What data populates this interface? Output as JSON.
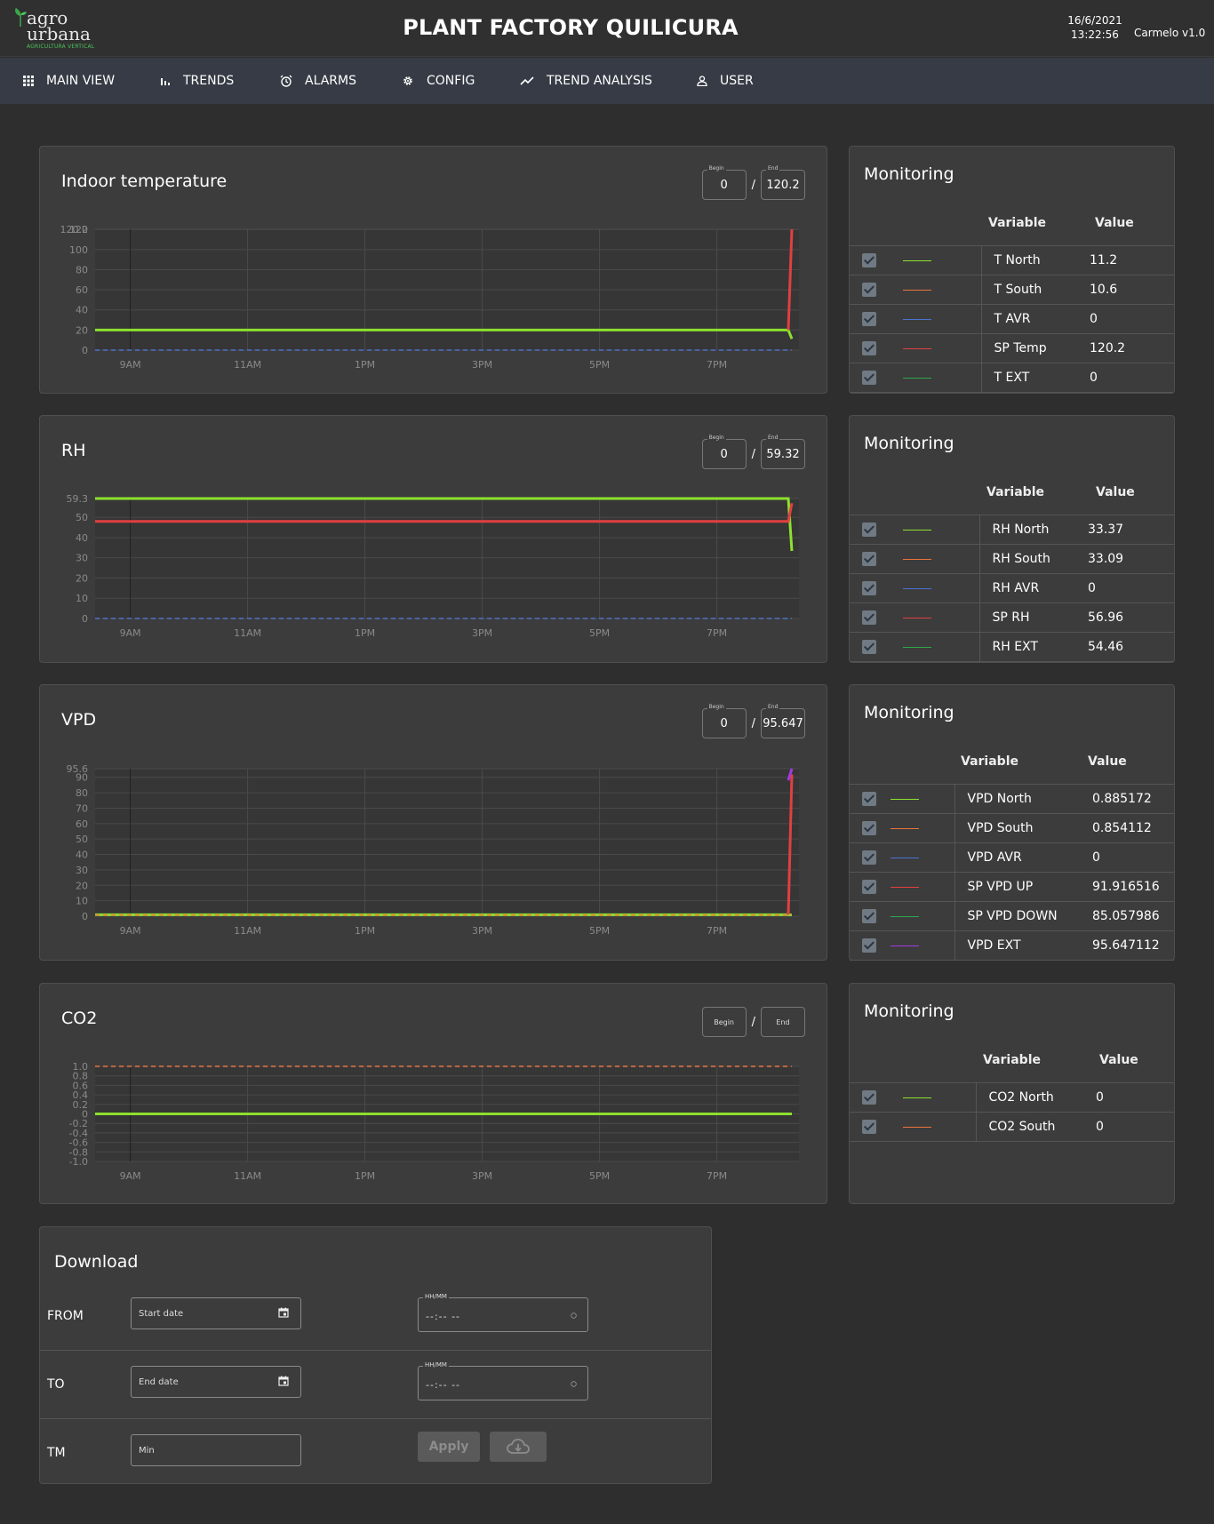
{
  "header": {
    "logo_line1": "agro",
    "logo_line2": "urbana",
    "logo_tagline": "AGRICULTURA VERTICAL",
    "title": "PLANT FACTORY QUILICURA",
    "date": "16/6/2021",
    "time": "13:22:56",
    "version": "Carmelo v1.0"
  },
  "nav": [
    {
      "label": "MAIN VIEW",
      "icon": "grid-icon"
    },
    {
      "label": "TRENDS",
      "icon": "bar-chart-icon"
    },
    {
      "label": "ALARMS",
      "icon": "alarm-clock-icon"
    },
    {
      "label": "CONFIG",
      "icon": "gear-icon"
    },
    {
      "label": "TREND ANALYSIS",
      "icon": "trending-up-icon"
    },
    {
      "label": "USER",
      "icon": "user-icon"
    }
  ],
  "range_labels": {
    "begin": "Begin",
    "end": "End",
    "separator": "/"
  },
  "colors": {
    "green": "#8de02e",
    "orange": "#e8743c",
    "blue": "#4a73d0",
    "red": "#e04040",
    "dark_green": "#2ea84a",
    "purple": "#a23ae0"
  },
  "monitoring_title": "Monitoring",
  "monitoring_columns": {
    "variable": "Variable",
    "value": "Value"
  },
  "charts": [
    {
      "title": "Indoor temperature",
      "begin": "0",
      "end": "120.2",
      "rows": [
        {
          "variable": "T North",
          "value": "11.2",
          "color": "#8de02e"
        },
        {
          "variable": "T South",
          "value": "10.6",
          "color": "#e8743c"
        },
        {
          "variable": "T AVR",
          "value": "0",
          "color": "#4a73d0"
        },
        {
          "variable": "SP Temp",
          "value": "120.2",
          "color": "#e04040"
        },
        {
          "variable": "T EXT",
          "value": "0",
          "color": "#2ea84a"
        }
      ]
    },
    {
      "title": "RH",
      "begin": "0",
      "end": "59.32",
      "rows": [
        {
          "variable": "RH North",
          "value": "33.37",
          "color": "#8de02e"
        },
        {
          "variable": "RH South",
          "value": "33.09",
          "color": "#e8743c"
        },
        {
          "variable": "RH AVR",
          "value": "0",
          "color": "#4a73d0"
        },
        {
          "variable": "SP RH",
          "value": "56.96",
          "color": "#e04040"
        },
        {
          "variable": "RH EXT",
          "value": "54.46",
          "color": "#2ea84a"
        }
      ]
    },
    {
      "title": "VPD",
      "begin": "0",
      "end": "95.647",
      "rows": [
        {
          "variable": "VPD North",
          "value": "0.885172",
          "color": "#8de02e"
        },
        {
          "variable": "VPD South",
          "value": "0.854112",
          "color": "#e8743c"
        },
        {
          "variable": "VPD AVR",
          "value": "0",
          "color": "#4a73d0"
        },
        {
          "variable": "SP VPD UP",
          "value": "91.916516",
          "color": "#e04040"
        },
        {
          "variable": "SP VPD DOWN",
          "value": "85.057986",
          "color": "#2ea84a"
        },
        {
          "variable": "VPD EXT",
          "value": "95.647112",
          "color": "#a23ae0"
        }
      ]
    },
    {
      "title": "CO2",
      "begin": "",
      "end": "",
      "rows": [
        {
          "variable": "CO2 North",
          "value": "0",
          "color": "#8de02e"
        },
        {
          "variable": "CO2 South",
          "value": "0",
          "color": "#e8743c"
        }
      ]
    }
  ],
  "chart_data": [
    {
      "type": "line",
      "ylim": [
        0,
        120.2
      ],
      "yticks": [
        "0",
        "20",
        "40",
        "60",
        "80",
        "100",
        "120",
        "120.2"
      ],
      "xticks": [
        "9AM",
        "11AM",
        "1PM",
        "3PM",
        "5PM",
        "7PM"
      ],
      "series": [
        {
          "name": "T North",
          "color": "#8de02e",
          "values": [
            20,
            20,
            20,
            20,
            20,
            20,
            20,
            20,
            11.2
          ]
        },
        {
          "name": "SP Temp",
          "color": "#e04040",
          "values": [
            null,
            null,
            null,
            null,
            null,
            null,
            null,
            20,
            120.2
          ]
        },
        {
          "name": "T AVR",
          "color": "#4a73d0",
          "dashed": true,
          "values": [
            0,
            0,
            0,
            0,
            0,
            0,
            0,
            0,
            0
          ]
        }
      ]
    },
    {
      "type": "line",
      "ylim": [
        0,
        59.3
      ],
      "yticks": [
        "0",
        "10",
        "20",
        "30",
        "40",
        "50",
        "59.3"
      ],
      "xticks": [
        "9AM",
        "11AM",
        "1PM",
        "3PM",
        "5PM",
        "7PM"
      ],
      "series": [
        {
          "name": "RH North",
          "color": "#8de02e",
          "values": [
            59.3,
            59.3,
            59.3,
            59.3,
            59.3,
            59.3,
            59.3,
            59.3,
            33.37
          ]
        },
        {
          "name": "SP RH",
          "color": "#e04040",
          "values": [
            48,
            48,
            48,
            48,
            48,
            48,
            48,
            48,
            56.96
          ]
        },
        {
          "name": "RH AVR",
          "color": "#4a73d0",
          "dashed": true,
          "values": [
            0,
            0,
            0,
            0,
            0,
            0,
            0,
            0,
            0
          ]
        }
      ]
    },
    {
      "type": "line",
      "ylim": [
        0,
        95.6
      ],
      "yticks": [
        "0",
        "10",
        "20",
        "30",
        "40",
        "50",
        "60",
        "70",
        "80",
        "90",
        "95.6"
      ],
      "xticks": [
        "9AM",
        "11AM",
        "1PM",
        "3PM",
        "5PM",
        "7PM"
      ],
      "series": [
        {
          "name": "VPD North",
          "color": "#8de02e",
          "values": [
            0.9,
            0.9,
            0.9,
            0.9,
            0.9,
            0.9,
            0.9,
            0.9,
            0.885172
          ]
        },
        {
          "name": "SP VPD UP",
          "color": "#e04040",
          "values": [
            null,
            null,
            null,
            null,
            null,
            null,
            null,
            0.9,
            91.916516
          ]
        },
        {
          "name": "VPD EXT",
          "color": "#a23ae0",
          "values": [
            null,
            null,
            null,
            null,
            null,
            null,
            null,
            88,
            95.647112
          ]
        },
        {
          "name": "VPD South",
          "color": "#e8743c",
          "dashed": true,
          "values": [
            0.8,
            0.8,
            0.8,
            0.8,
            0.8,
            0.8,
            0.8,
            0.8,
            0.854112
          ]
        }
      ]
    },
    {
      "type": "line",
      "ylim": [
        -1.0,
        1.0
      ],
      "yticks": [
        "-1.0",
        "-0.8",
        "-0.6",
        "-0.4",
        "-0.2",
        "0",
        "0.2",
        "0.4",
        "0.6",
        "0.8",
        "1.0"
      ],
      "xticks": [
        "9AM",
        "11AM",
        "1PM",
        "3PM",
        "5PM",
        "7PM"
      ],
      "series": [
        {
          "name": "CO2 North",
          "color": "#8de02e",
          "values": [
            0,
            0,
            0,
            0,
            0,
            0,
            0,
            0,
            0
          ]
        },
        {
          "name": "CO2 South",
          "color": "#e8743c",
          "dashed": true,
          "values": [
            1,
            1,
            1,
            1,
            1,
            1,
            1,
            1,
            1
          ]
        }
      ]
    }
  ],
  "download": {
    "title": "Download",
    "from_label": "FROM",
    "to_label": "TO",
    "tm_label": "TM",
    "start_placeholder": "Start date",
    "end_placeholder": "End date",
    "min_placeholder": "Min",
    "time_label": "HH/MM",
    "time_value": "--:-- --",
    "apply_label": "Apply"
  }
}
